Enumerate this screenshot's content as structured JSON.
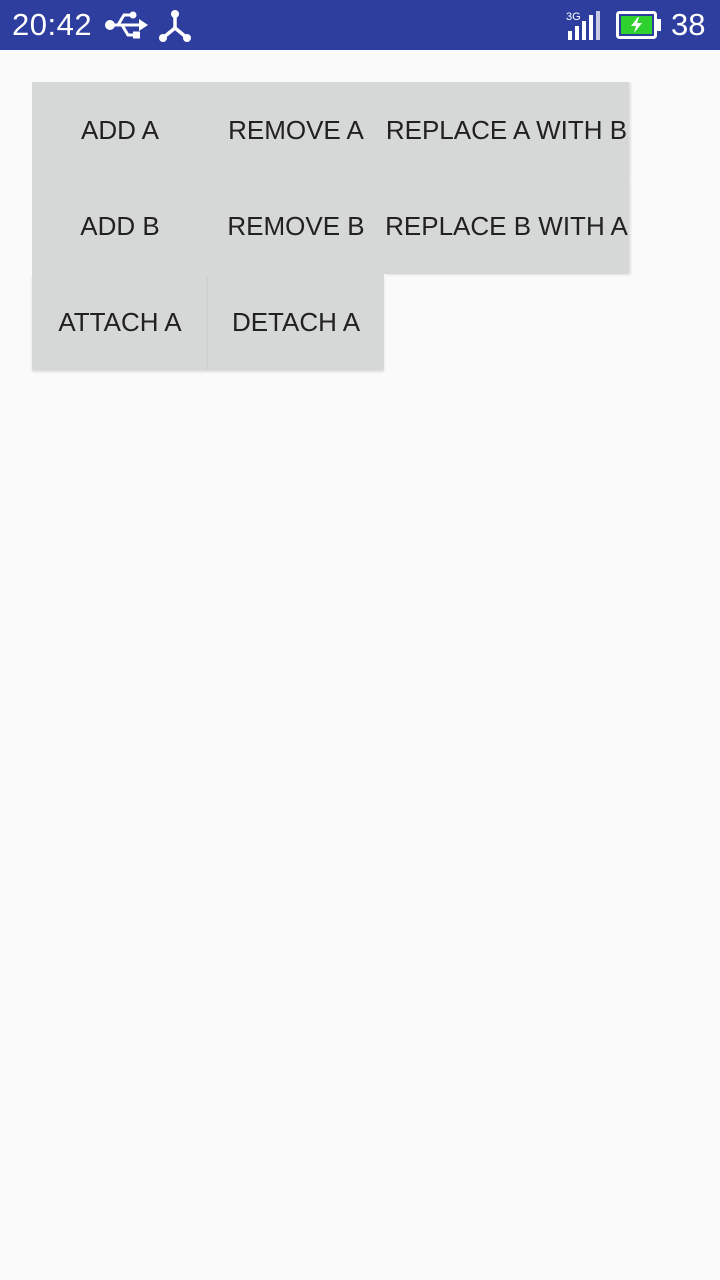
{
  "status_bar": {
    "time": "20:42",
    "battery_level": "38",
    "icons": [
      "usb-icon",
      "share-icon",
      "signal-3g-icon",
      "battery-charging-icon"
    ],
    "signal_label": "3G",
    "colors": {
      "background": "#2d3e9f",
      "battery_fill": "#2fd12f"
    }
  },
  "buttons": {
    "add_a": "ADD A",
    "remove_a": "REMOVE A",
    "replace_a_with_b": "REPLACE A WITH B",
    "add_b": "ADD B",
    "remove_b": "REMOVE B",
    "replace_b_with_a": "REPLACE B WITH A",
    "attach_a": "ATTACH A",
    "detach_a": "DETACH A"
  },
  "colors": {
    "page_background": "#fafafa",
    "button_background": "#d6d7d7",
    "button_text": "#212121"
  }
}
